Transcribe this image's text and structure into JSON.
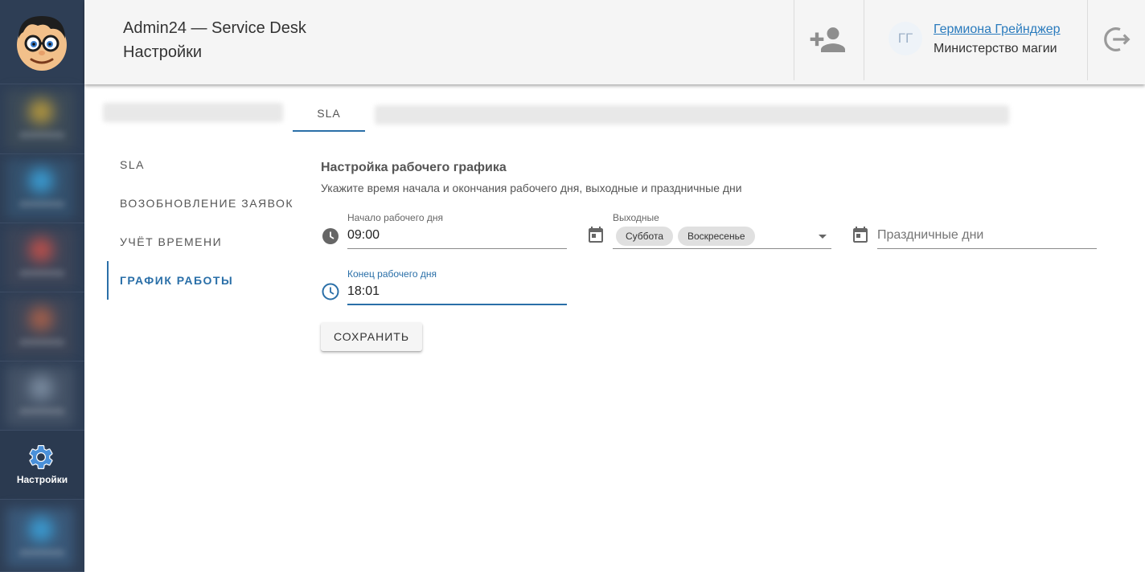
{
  "sidebar": {
    "active_item": {
      "label": "Настройки",
      "icon": "gear-icon"
    },
    "blurred_items_count": 6
  },
  "header": {
    "app_title": "Admin24 — Service Desk",
    "page_title": "Настройки",
    "add_user_icon": "person-add-icon",
    "user": {
      "initials": "ГГ",
      "name": "Гермиона Грейнджер",
      "organization": "Министерство магии"
    },
    "logout_icon": "logout-icon"
  },
  "tabs": {
    "active": "SLA"
  },
  "subnav": {
    "items": [
      {
        "label": "SLA"
      },
      {
        "label": "Возобновление заявок"
      },
      {
        "label": "Учёт времени"
      },
      {
        "label": "График работы"
      }
    ],
    "active_index": 3
  },
  "schedule": {
    "title": "Настройка рабочего графика",
    "subtitle": "Укажите время начала и окончания рабочего дня, выходные и праздничные дни",
    "start": {
      "label": "Начало рабочего дня",
      "value": "09:00"
    },
    "end": {
      "label": "Конец рабочего дня",
      "value": "18:01"
    },
    "weekends": {
      "label": "Выходные",
      "chips": [
        "Суббота",
        "Воскресенье"
      ]
    },
    "holidays": {
      "placeholder": "Праздничные дни"
    },
    "save_label": "СОХРАНИТЬ"
  },
  "colors": {
    "sidebar_bg": "#2e3e55",
    "accent": "#2a6fa8",
    "link": "#2a7bbd",
    "header_bg": "#f5f5f5"
  }
}
